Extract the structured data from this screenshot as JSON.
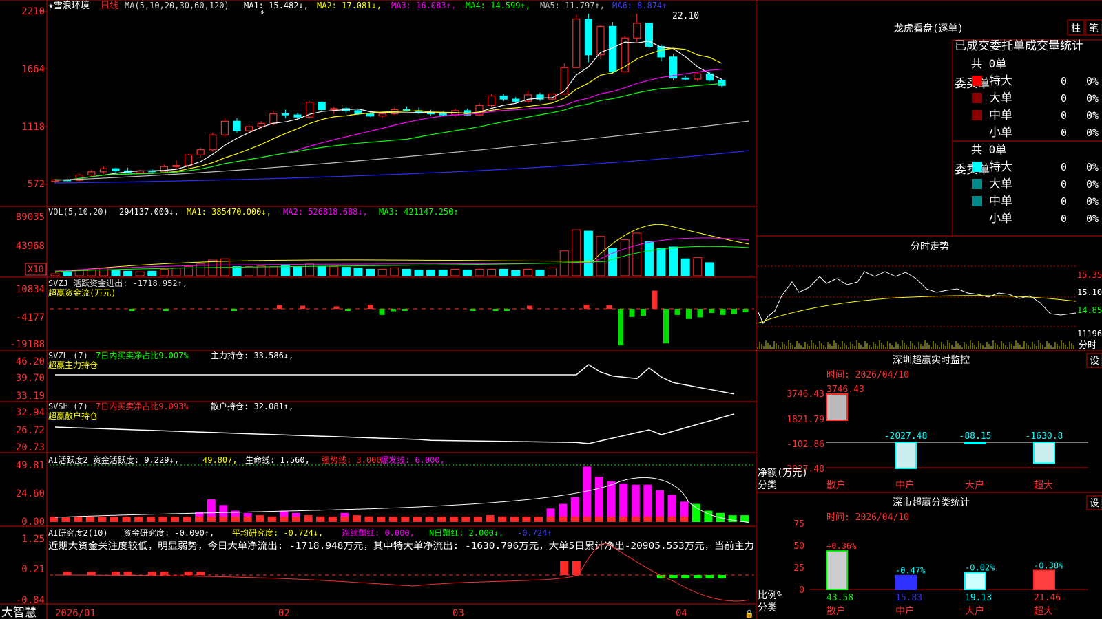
{
  "stock": {
    "star": "★",
    "name": "雪浪环境",
    "period": "日线"
  },
  "colors": {
    "up": "#ff2a2a",
    "down": "#00ffff",
    "bg": "#000000",
    "frame": "#c80000",
    "ma1": "#ffffff",
    "ma2": "#ffff00",
    "ma3": "#ff00ff",
    "ma4": "#00ff00",
    "ma5": "#c0c0c0",
    "ma6": "#2b2bff",
    "green_bar": "#00ff00",
    "magenta_bar": "#ff00ff"
  },
  "price_panel": {
    "title": "MA(5,10,20,30,60,120)",
    "ma1": "MA1: 15.482↓,",
    "ma2": "MA2: 17.081↓,",
    "ma3": "MA3: 16.083↑,",
    "ma4": "MA4: 14.599↑,",
    "ma5": "MA5: 11.797↑,",
    "ma6": "MA6: 8.874↑",
    "y_ticks": [
      "2210",
      "1664",
      "1118",
      "572"
    ],
    "high_label": "22.10",
    "asterisk": "*"
  },
  "vol_panel": {
    "title": "VOL(5,10,20)",
    "value": "294137.000↓,",
    "ma1": "MA1: 385470.000↓,",
    "ma2": "MA2: 526818.688↓,",
    "ma3": "MA3: 421147.250↑",
    "y_ticks": [
      "89035",
      "43968"
    ],
    "unit": "X10"
  },
  "svzj_panel": {
    "title": "SVZJ  活跃资金进出: -1718.952↑,",
    "subtitle": "超赢资金流(万元)",
    "y_ticks": [
      "10834",
      "-4177",
      "-19188"
    ]
  },
  "svzl_panel": {
    "title": "SVZL (7)",
    "t2": "7日内买卖净占比9.007%",
    "t3": "主力持仓: 33.586↓,",
    "subtitle": "超赢主力持仓",
    "y_ticks": [
      "46.20",
      "39.70",
      "33.19"
    ]
  },
  "svsh_panel": {
    "title": "SVSH (7)",
    "t2": "7日内买卖净占比9.093%",
    "t3": "散户持仓: 32.081↑,",
    "subtitle": "超赢散户持仓",
    "y_ticks": [
      "32.94",
      "26.72",
      "20.73"
    ]
  },
  "ai_act_panel": {
    "title": "AI活跃度2 资金活跃度: 9.229↓,",
    "t2": "49.807,",
    "t3": "生命线: 1.560,",
    "t4": "强势线: 3.000,",
    "t5": "爆发线: 6.000,",
    "y_ticks": [
      "49.81",
      "24.60",
      "0.00"
    ]
  },
  "ai_res_panel": {
    "title": "AI研究度2(10)",
    "t2": "资金研究度: -0.090↑,",
    "t3": "平均研究度: -0.724↓,",
    "t4": "连续飘红: 0.000,",
    "t5": "N日飘红: 2.000↓,",
    "t6": "-0.724↑",
    "summary": "近期大资金关注度较低，明显弱势，今日大单净流出: -1718.948万元，其中特大单净流出: -1630.796万元，大单5日累计净出-20905.553万元，当前主力",
    "y_ticks": [
      "1.25",
      "0.21",
      "-0.84"
    ]
  },
  "x_axis": {
    "labels": [
      "2026/01",
      "02",
      "03",
      "04"
    ],
    "brand": "大智慧"
  },
  "right": {
    "lhb_title": "龙虎看盘(逐单)",
    "btn_zhu": "柱",
    "btn_bi": "笔",
    "tabs": "已成交委托单成交量统计",
    "buy_label": "委买单",
    "sell_label": "委卖单",
    "buy_total": "共 0单",
    "sell_total": "共 0单",
    "buy_rows": [
      {
        "name": "特大",
        "count": "0",
        "pct": "0%"
      },
      {
        "name": "大单",
        "count": "0",
        "pct": "0%"
      },
      {
        "name": "中单",
        "count": "0",
        "pct": "0%"
      },
      {
        "name": "小单",
        "count": "0",
        "pct": "0%"
      }
    ],
    "sell_rows": [
      {
        "name": "特大",
        "count": "0",
        "pct": "0%"
      },
      {
        "name": "大单",
        "count": "0",
        "pct": "0%"
      },
      {
        "name": "中单",
        "count": "0",
        "pct": "0%"
      },
      {
        "name": "小单",
        "count": "0",
        "pct": "0%"
      }
    ],
    "buy_colors": [
      "#ff0000",
      "#8b0000",
      "#8b0000",
      "#000000"
    ],
    "sell_colors": [
      "#00ffff",
      "#008b8b",
      "#008b8b",
      "#000000"
    ],
    "intraday_title": "分时走势",
    "intraday_ticks": [
      "15.35",
      "15.10",
      "14.85",
      "11196"
    ],
    "intraday_label": "分时",
    "monitor_title": "深圳超赢实时监控",
    "monitor_btn": "设",
    "monitor_time": "时间: 2026/04/10",
    "monitor_ticks": [
      "3746.43",
      "1821.79",
      "-102.86",
      "-2027.48"
    ],
    "monitor_values": [
      "3746.43",
      "-2027.48",
      "-88.15",
      "-1630.8"
    ],
    "monitor_vals_num": [
      3746.43,
      -2027.48,
      -88.15,
      -1630.8
    ],
    "monitor_ylabel1": "净额(万元)",
    "monitor_ylabel2": "分类",
    "cats": [
      "散户",
      "中户",
      "大户",
      "超大"
    ],
    "stats_title": "深市超赢分类统计",
    "stats_btn": "设",
    "stats_time": "时间: 2026/04/10",
    "stats_ticks": [
      "75",
      "50",
      "25",
      "0"
    ],
    "stats_top": [
      "+0.36%",
      "-0.47%",
      "-0.02%",
      "-0.38%"
    ],
    "stats_bottom": [
      "43.58",
      "15.83",
      "19.13",
      "21.46"
    ],
    "stats_vals": [
      43.58,
      15.83,
      19.13,
      21.46
    ],
    "stats_ylabel1": "比例%",
    "stats_ylabel2": "分类"
  },
  "chart_data": [
    {
      "type": "candlestick",
      "title": "雪浪环境 日线",
      "ylim": [
        5.72,
        22.1
      ],
      "ohlc": [
        [
          6.2,
          6.45,
          6.0,
          6.35
        ],
        [
          6.35,
          6.55,
          6.2,
          6.3
        ],
        [
          6.3,
          6.9,
          6.2,
          6.8
        ],
        [
          6.8,
          7.3,
          6.7,
          7.1
        ],
        [
          7.1,
          7.6,
          6.9,
          7.4
        ],
        [
          7.4,
          7.5,
          7.0,
          7.2
        ],
        [
          7.2,
          7.5,
          7.0,
          7.05
        ],
        [
          7.0,
          7.3,
          6.9,
          7.2
        ],
        [
          7.2,
          7.4,
          7.0,
          7.15
        ],
        [
          7.1,
          7.8,
          7.0,
          7.6
        ],
        [
          7.6,
          8.2,
          7.4,
          7.7
        ],
        [
          7.7,
          8.8,
          7.5,
          8.7
        ],
        [
          8.7,
          9.4,
          8.5,
          9.2
        ],
        [
          9.2,
          10.8,
          9.0,
          10.6
        ],
        [
          10.6,
          12.2,
          10.4,
          11.9
        ],
        [
          11.9,
          12.2,
          10.8,
          11.0
        ],
        [
          11.0,
          11.6,
          10.9,
          11.4
        ],
        [
          11.4,
          11.9,
          11.1,
          11.7
        ],
        [
          11.7,
          12.9,
          11.5,
          12.6
        ],
        [
          12.6,
          13.0,
          12.2,
          12.5
        ],
        [
          12.5,
          12.7,
          12.0,
          12.3
        ],
        [
          12.3,
          13.8,
          12.2,
          13.7
        ],
        [
          13.7,
          13.8,
          12.8,
          13.0
        ],
        [
          13.0,
          13.3,
          12.6,
          13.1
        ],
        [
          13.1,
          13.3,
          12.7,
          12.9
        ],
        [
          12.9,
          13.1,
          12.5,
          12.6
        ],
        [
          12.6,
          12.9,
          12.3,
          12.4
        ],
        [
          12.4,
          12.8,
          12.2,
          12.6
        ],
        [
          12.6,
          13.2,
          12.5,
          13.0
        ],
        [
          13.0,
          13.3,
          12.8,
          12.9
        ],
        [
          12.9,
          13.2,
          12.6,
          12.7
        ],
        [
          12.7,
          13.0,
          12.4,
          12.6
        ],
        [
          12.6,
          12.9,
          12.4,
          12.5
        ],
        [
          12.5,
          13.1,
          12.3,
          12.9
        ],
        [
          12.9,
          13.1,
          12.4,
          12.5
        ],
        [
          12.5,
          13.6,
          12.4,
          13.4
        ],
        [
          13.4,
          14.5,
          13.2,
          14.3
        ],
        [
          14.3,
          14.5,
          13.8,
          14.0
        ],
        [
          14.0,
          14.2,
          13.6,
          13.8
        ],
        [
          13.8,
          14.8,
          13.6,
          14.4
        ],
        [
          14.4,
          14.6,
          13.8,
          14.0
        ],
        [
          14.0,
          14.8,
          13.9,
          14.5
        ],
        [
          14.5,
          17.4,
          14.4,
          17.0
        ],
        [
          17.0,
          22.0,
          17.0,
          21.6
        ],
        [
          21.6,
          22.1,
          17.5,
          18.2
        ],
        [
          18.2,
          21.0,
          17.8,
          20.9
        ],
        [
          20.9,
          21.3,
          16.4,
          16.6
        ],
        [
          16.6,
          20.0,
          16.5,
          19.8
        ],
        [
          19.8,
          22.1,
          19.4,
          21.2
        ],
        [
          21.2,
          21.2,
          18.8,
          19.0
        ],
        [
          19.0,
          19.2,
          17.6,
          18.0
        ],
        [
          18.0,
          18.3,
          15.8,
          16.0
        ],
        [
          16.0,
          16.2,
          15.8,
          15.9
        ],
        [
          15.9,
          16.6,
          15.7,
          16.4
        ],
        [
          16.4,
          16.6,
          15.7,
          15.8
        ],
        [
          15.8,
          15.9,
          15.1,
          15.3
        ]
      ]
    },
    {
      "type": "bar",
      "title": "VOL(5,10,20)",
      "ylim": [
        0,
        89035
      ],
      "values": [
        3000,
        6000,
        8000,
        9000,
        12000,
        8000,
        7000,
        6000,
        7000,
        10000,
        12000,
        14000,
        18000,
        24000,
        26000,
        14000,
        14000,
        15000,
        14000,
        16000,
        14000,
        18000,
        14000,
        14000,
        13000,
        12000,
        10000,
        10000,
        12000,
        10000,
        9000,
        9000,
        9000,
        10000,
        9000,
        10000,
        10000,
        10000,
        8000,
        10000,
        9000,
        12000,
        38000,
        70000,
        68000,
        60000,
        42000,
        55000,
        65000,
        52000,
        42000,
        44000,
        26000,
        28000,
        20000
      ]
    },
    {
      "type": "bar",
      "title": "SVZJ 活跃资金进出",
      "ylim": [
        -19188,
        10834
      ],
      "values": [
        0,
        0,
        0,
        0,
        0,
        0,
        0,
        -400,
        0,
        0,
        -500,
        0,
        0,
        0,
        0,
        0,
        -600,
        0,
        0,
        0,
        1800,
        0,
        1500,
        0,
        0,
        1200,
        -800,
        0,
        2000,
        -3000,
        -1200,
        -600,
        0,
        0,
        0,
        0,
        0,
        -600,
        0,
        -500,
        -700,
        0,
        1500,
        0,
        0,
        0,
        0,
        2000,
        0,
        1800,
        -18000,
        -4000,
        -3500,
        9000,
        -17000,
        -3000,
        -5000,
        -4200,
        -2000,
        -3000,
        -2500,
        -1719
      ]
    }
  ]
}
